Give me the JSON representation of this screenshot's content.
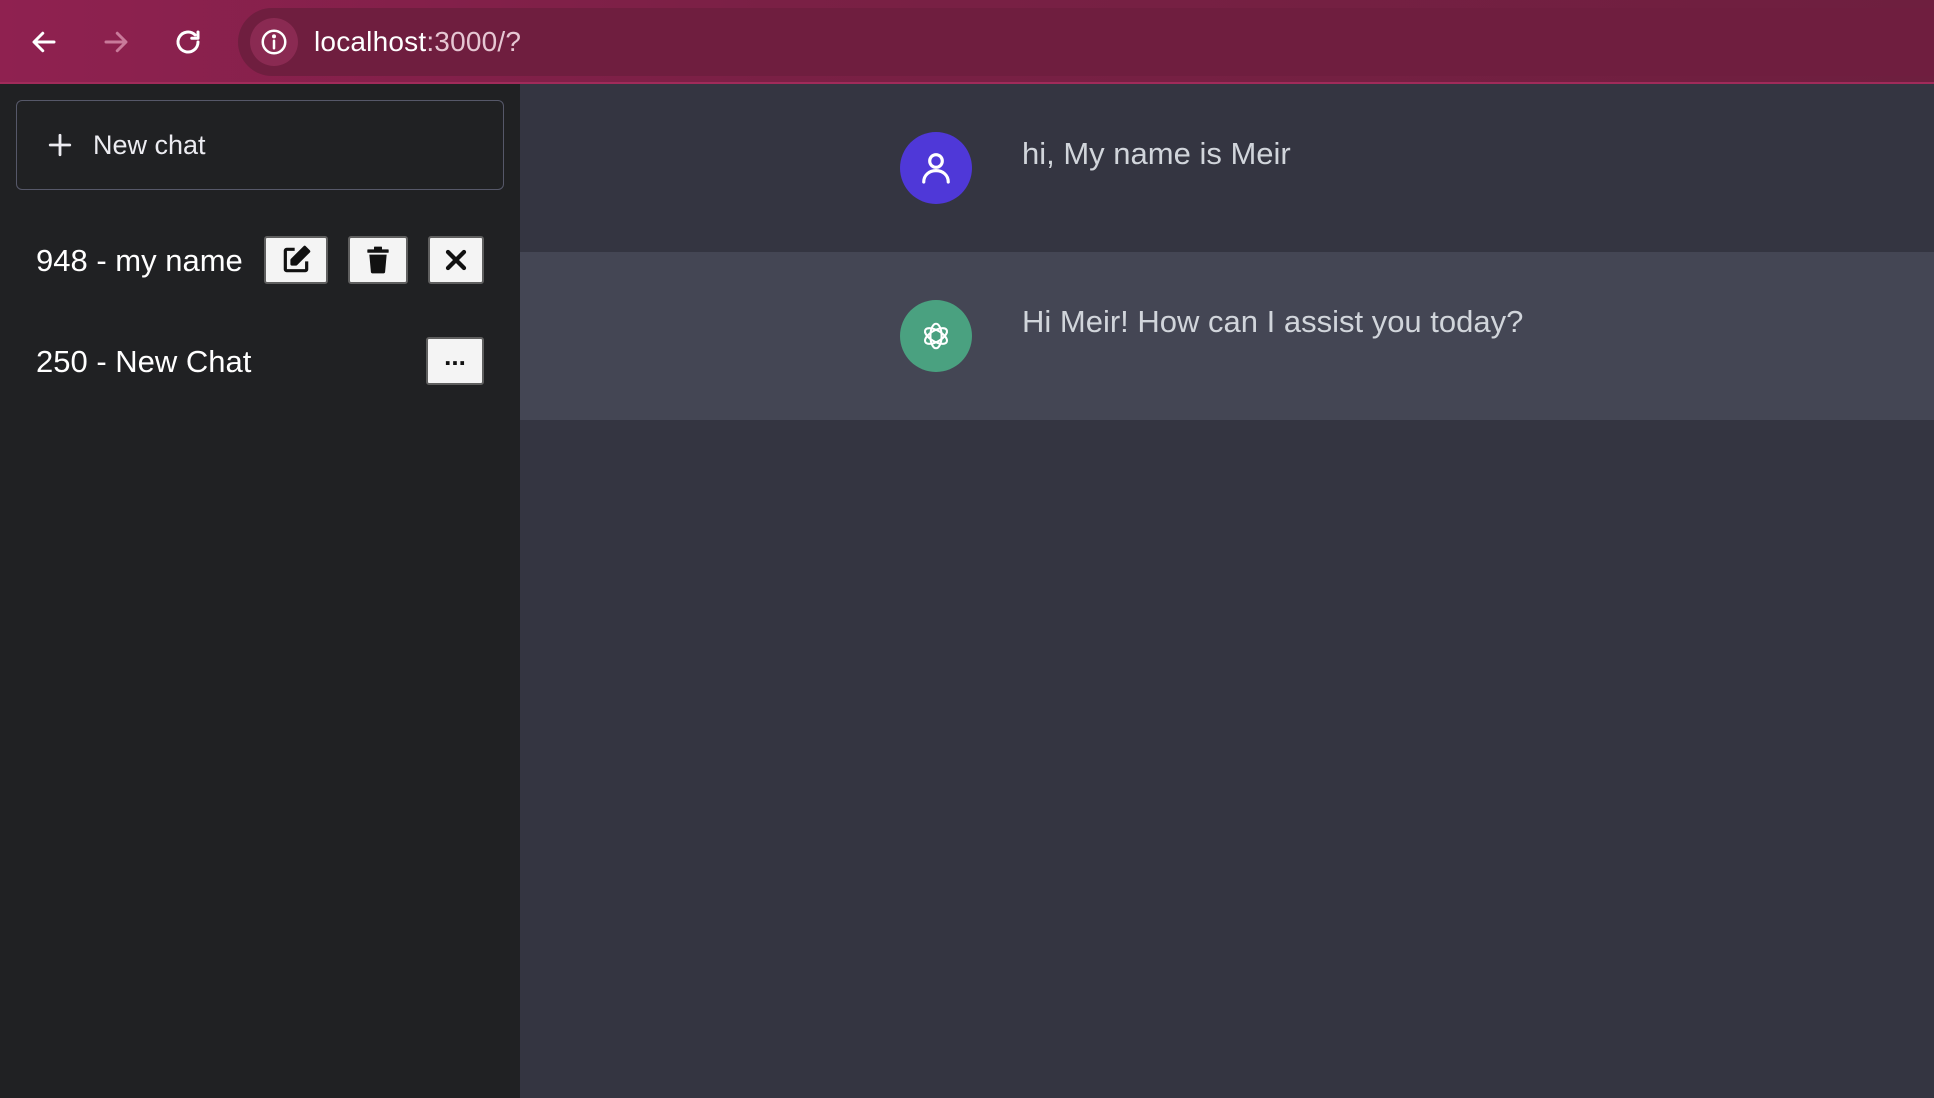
{
  "browser": {
    "back_icon": "arrow-left-icon",
    "forward_icon": "arrow-right-icon",
    "reload_icon": "reload-icon",
    "site_info_icon": "info-icon",
    "url_host": "localhost",
    "url_rest": ":3000/?"
  },
  "sidebar": {
    "new_chat_label": "New chat",
    "chats": [
      {
        "title": "948 - my name",
        "actions": [
          "edit-icon",
          "trash-icon",
          "close-icon"
        ]
      },
      {
        "title": "250 - New Chat",
        "more_label": "..."
      }
    ]
  },
  "conversation": [
    {
      "role": "user",
      "avatar_icon": "user-icon",
      "text": "hi, My name is Meir"
    },
    {
      "role": "assistant",
      "avatar_icon": "openai-logo-icon",
      "text": "Hi Meir! How can I assist you today?"
    }
  ],
  "colors": {
    "toolbar": "#7a2045",
    "sidebar": "#202123",
    "main": "#343541",
    "assistant_row": "#444654",
    "user_avatar": "#4f38d8",
    "bot_avatar": "#4aa180"
  }
}
